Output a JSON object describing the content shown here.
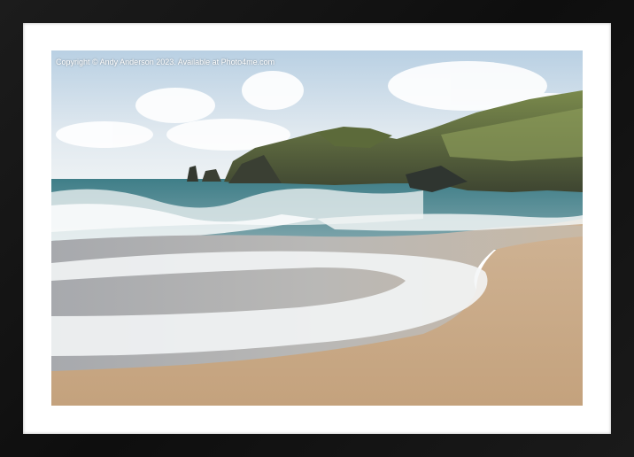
{
  "watermark": {
    "text": "Copyright © Andy Anderson 2023. Available at Photo4me.com"
  },
  "colors": {
    "frame": "#141414",
    "mount": "#ffffff",
    "sky": "#d9e4ee",
    "sea": "#5f8f96",
    "foam": "#eef2f3",
    "sand": "#c9ab88",
    "cliff": "#4f5a3c"
  }
}
